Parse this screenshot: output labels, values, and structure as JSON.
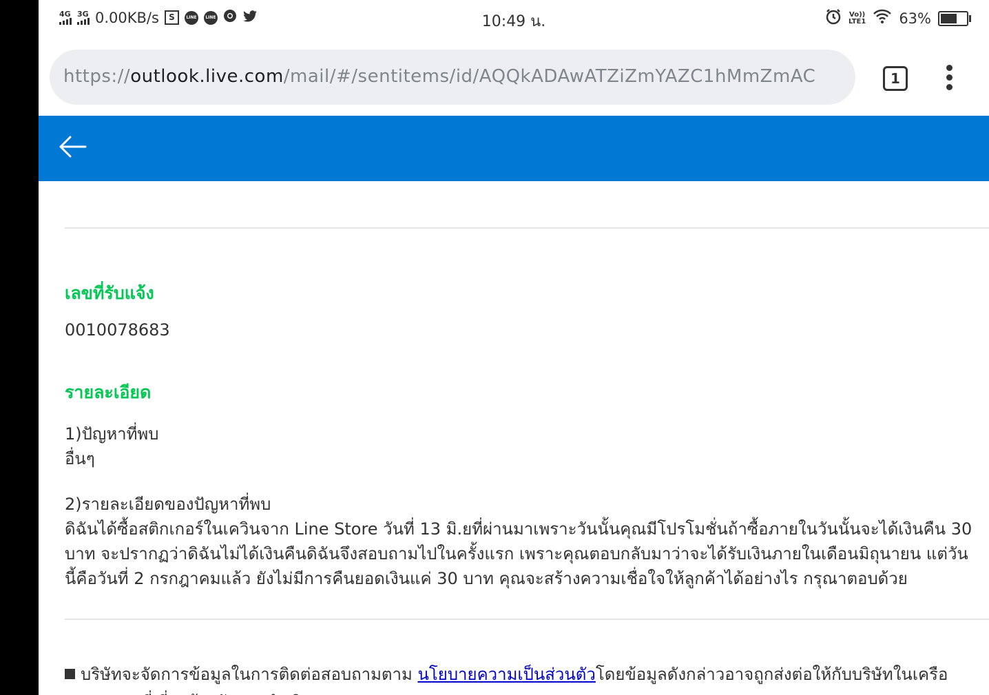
{
  "status_bar": {
    "net1": "4G",
    "net2": "3G",
    "speed": "0.00KB/s",
    "time": "10:49 น.",
    "volte_top": "Vo))",
    "volte_bottom": "LTE1",
    "battery_percent": "63%",
    "battery_level": 0.63
  },
  "browser": {
    "url_scheme": "https://",
    "url_host": "outlook.live.com",
    "url_path": "/mail/#/sentitems/id/AQQkADAwATZiZmYAZC1hMmZmAC",
    "tab_count": "1"
  },
  "email": {
    "ticket_label": "เลขที่รับแจ้ง",
    "ticket_number": "0010078683",
    "details_label": "รายละเอียด",
    "problem_heading": "1)ปัญหาที่พบ",
    "problem_value": "อื่นๆ",
    "details_heading": "2)รายละเอียดของปัญหาที่พบ",
    "details_line1": "ดิฉันได้ซื้อสติกเกอร์ในเควินจาก Line Store วันที่ 13 มิ.ยที่ผ่านมาเพราะวันนั้นคุณมีโปรโมชั่นถ้าซื้อภายในวันนั้นจะได้เงินคืน 30",
    "details_line2": "บาท จะปรากฏว่าดิฉันไม่ได้เงินคืนดิฉันจึงสอบถามไปในครั้งแรก เพราะคุณตอบกลับมาว่าจะได้รับเงินภายในเดือนมิถุนายน แต่วัน",
    "details_line3": "นี้คือวันที่ 2 กรกฎาคมแล้ว ยังไม่มีการคืนยอดเงินแค่ 30 บาท คุณจะสร้างความเชื่อใจให้ลูกค้าได้อย่างไร กรุณาตอบด้วย",
    "footer_prefix": "บริษัทจะจัดการข้อมูลในการติดต่อสอบถามตาม ",
    "footer_link": "นโยบายความเป็นส่วนตัว",
    "footer_suffix": "โดยข้อมูลดังกล่าวอาจถูกส่งต่อให้กับบริษัทในเครือ",
    "footer_cut": "ของ LINE ที่เกี่ยวข้องกับการดำเนินการ"
  },
  "colors": {
    "header_blue": "#0078d4",
    "section_green": "#06c755",
    "link_blue": "#0000cc"
  }
}
